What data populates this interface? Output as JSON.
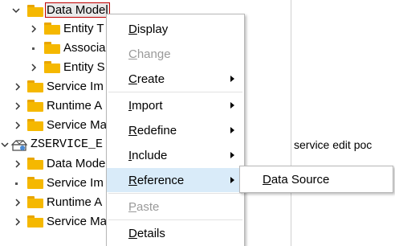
{
  "tree": {
    "rows": [
      {
        "label": "Data Model"
      },
      {
        "label": "Entity T"
      },
      {
        "label": "Associa"
      },
      {
        "label": "Entity S"
      },
      {
        "label": "Service Im"
      },
      {
        "label": "Runtime A"
      },
      {
        "label": "Service Ma"
      },
      {
        "label": "ZSERVICE_E"
      },
      {
        "label": "Data Mode"
      },
      {
        "label": "Service Im"
      },
      {
        "label": "Runtime A"
      },
      {
        "label": "Service Ma"
      }
    ]
  },
  "right_panel": {
    "description": "service edit poc"
  },
  "context_menu": {
    "items": [
      {
        "label": "Display",
        "mnemonic": "D",
        "rest": "isplay"
      },
      {
        "label": "Change",
        "mnemonic": "C",
        "rest": "hange"
      },
      {
        "label": "Create",
        "mnemonic": "C",
        "rest": "reate"
      },
      {
        "label": "Import",
        "mnemonic": "I",
        "rest": "mport"
      },
      {
        "label": "Redefine",
        "mnemonic": "R",
        "rest": "edefine"
      },
      {
        "label": "Include",
        "mnemonic": "I",
        "rest": "nclude"
      },
      {
        "label": "Reference",
        "mnemonic": "R",
        "rest": "eference"
      },
      {
        "label": "Paste",
        "mnemonic": "P",
        "rest": "aste"
      },
      {
        "label": "Details",
        "mnemonic": "D",
        "rest": "etails"
      }
    ]
  },
  "submenu": {
    "items": [
      {
        "label": "Data Source",
        "mnemonic": "D",
        "rest": "ata Source"
      }
    ]
  },
  "colors": {
    "folder": "#f5b800",
    "highlight": "#d9ebf9",
    "disabled_text": "#9a9a9a",
    "selection_border": "#c00000"
  }
}
